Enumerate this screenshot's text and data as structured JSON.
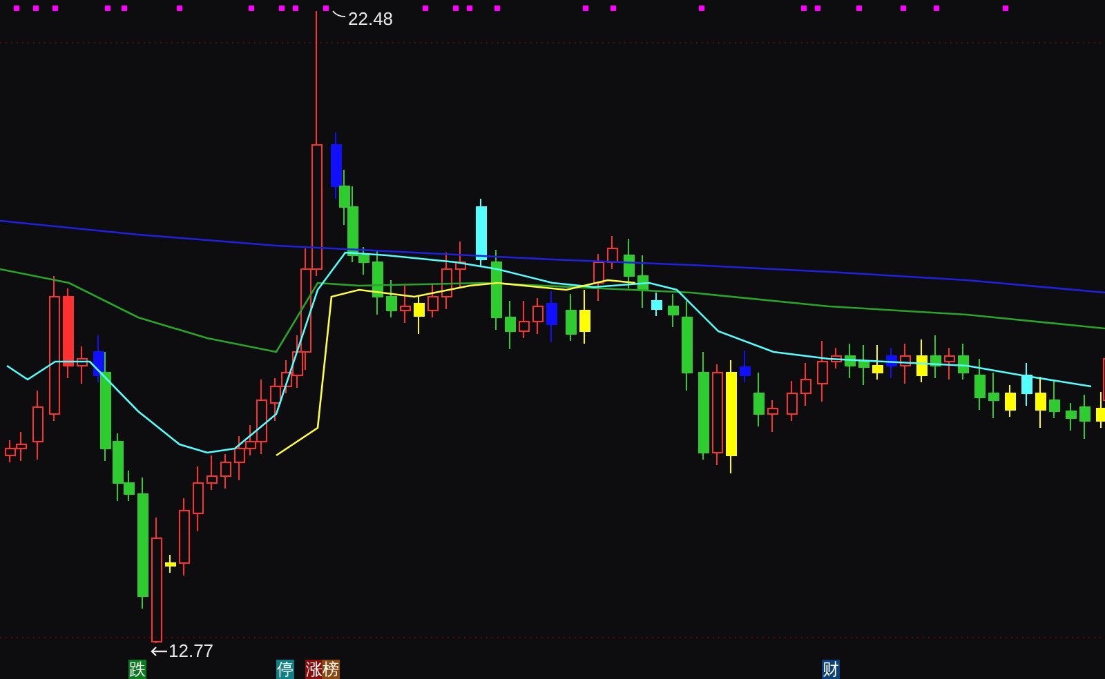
{
  "chart": {
    "high_label": "22.48",
    "low_label": "12.77"
  },
  "badges": [
    {
      "text": "跌",
      "color": "#0b7a1e"
    },
    {
      "text": "停",
      "color": "#0f7f86"
    },
    {
      "text": "涨",
      "color": "#8a0d0d"
    },
    {
      "text": "榜",
      "color": "#8b4a12"
    },
    {
      "text": "财",
      "color": "#0d3f78"
    }
  ]
}
